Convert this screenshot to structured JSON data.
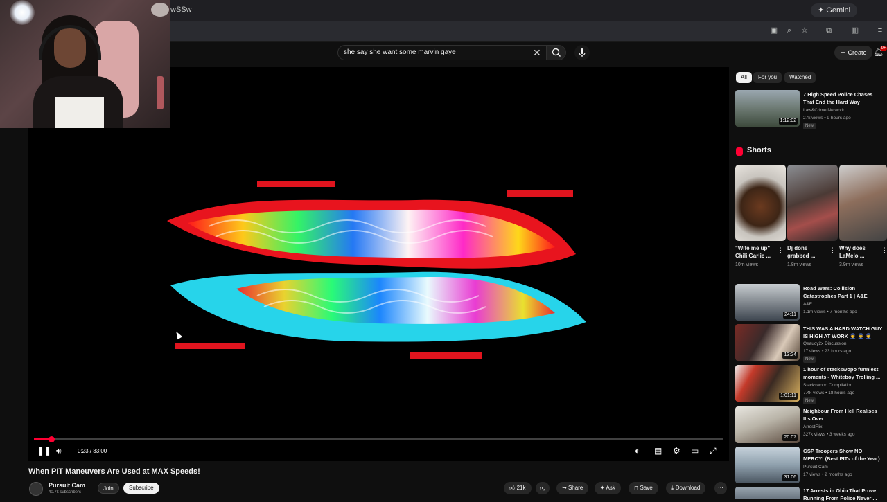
{
  "browser": {
    "gemini_label": "Gemini",
    "url_fragment": "wSSw",
    "minimize_symbol": "—"
  },
  "search": {
    "query": "she say she want some marvin gaye",
    "clear_symbol": "✕"
  },
  "masthead": {
    "create_label": "Create",
    "notification_count": "9+"
  },
  "player": {
    "time": "0:23 / 33:00",
    "progress": 0.0116
  },
  "video": {
    "title": "When PIT Maneuvers Are Used at MAX Speeds!",
    "channel": "Pursuit Cam",
    "subscribers": "40.7k subscribers",
    "join_label": "Join",
    "subscribe_label": "Subscribe",
    "like_count": "21k",
    "share_label": "Share",
    "ask_label": "Ask",
    "save_label": "Save",
    "download_label": "Download"
  },
  "chips": [
    "All",
    "For you",
    "Watched"
  ],
  "shorts_header": "Shorts",
  "recommendations_top": {
    "title": "7 High Speed Police Chases That End the Hard Way",
    "channel": "Law&Crime Network",
    "meta": "27k views • 9 hours ago",
    "badge": "New",
    "duration": "1:12:02"
  },
  "shorts": [
    {
      "title": "\"Wife me up\" Chili Garlic ...",
      "views": "10m views"
    },
    {
      "title": "Dj done grabbed ...",
      "views": "1.8m views"
    },
    {
      "title": "Why does LaMelo ...",
      "views": "3.9m views"
    }
  ],
  "recommendations": [
    {
      "title": "Road Wars: Collision Catastrophes Part 1 | A&E",
      "channel": "A&E",
      "meta": "1.1m views • 7 months ago",
      "badge": "",
      "duration": "24:11"
    },
    {
      "title": "THIS WAS A HARD WATCH GUY IS HIGH AT WORK 👮 👮 👮",
      "channel": "Qeaucy2x Discussion",
      "meta": "17 views • 23 hours ago",
      "badge": "New",
      "duration": "13:24"
    },
    {
      "title": "1 hour of stackswopo funniest moments - Whiteboy Trolling ...",
      "channel": "Stackswopo Compilation",
      "meta": "7.4k views • 18 hours ago",
      "badge": "New",
      "duration": "1:01:11"
    },
    {
      "title": "Neighbour From Hell Realises It's Over",
      "channel": "ArrestFlix",
      "meta": "327k views • 3 weeks ago",
      "badge": "",
      "duration": "20:07"
    },
    {
      "title": "GSP Troopers Show NO MERCY! (Best PITs of the Year)",
      "channel": "Pursuit Cam",
      "meta": "17 views • 2 months ago",
      "badge": "",
      "duration": "31:06"
    },
    {
      "title": "17 Arrests in Ohio That Prove Running From Police Never ...",
      "channel": "",
      "meta": "",
      "badge": "",
      "duration": ""
    }
  ]
}
